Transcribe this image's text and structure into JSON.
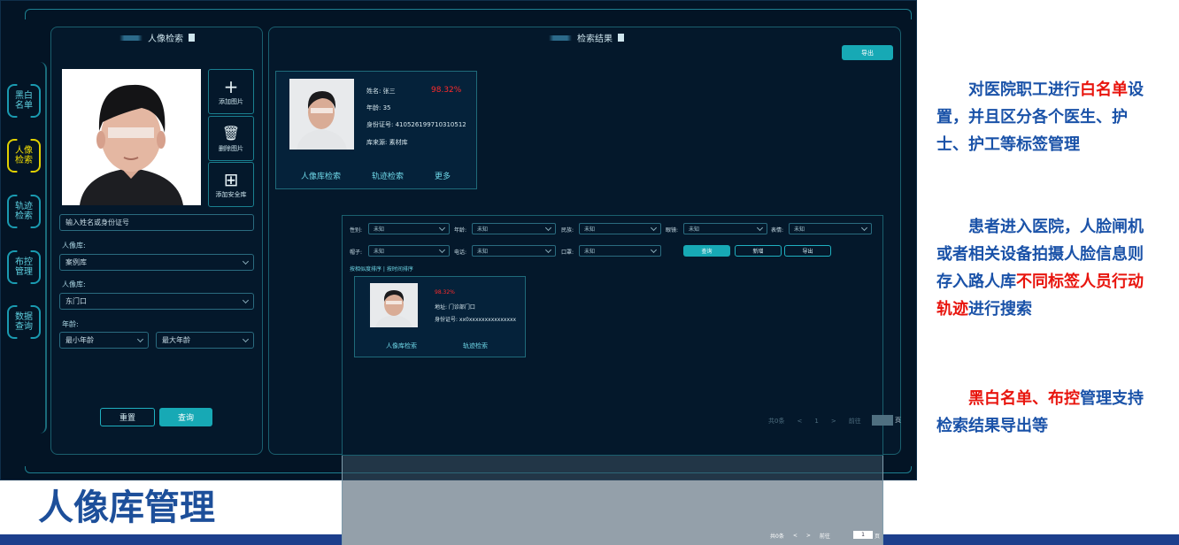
{
  "left_panel": {
    "title": "人像检索",
    "tools": [
      {
        "icon": "plus-icon",
        "glyph": "+",
        "label": "添加图片"
      },
      {
        "icon": "trash-icon",
        "glyph": "🗑",
        "label": "删除图片"
      },
      {
        "icon": "grid-icon",
        "glyph": "⊞",
        "label": "添加安全库"
      }
    ],
    "search_placeholder": "输入姓名或身份证号",
    "library_label_1": "人像库:",
    "library_value_1": "案例库",
    "library_label_2": "人像库:",
    "library_value_2": "东门口",
    "age_label": "年龄:",
    "age_min": "最小年龄",
    "age_max": "最大年龄",
    "reset_button": "重置",
    "search_button": "查询"
  },
  "sidebar": {
    "items": [
      {
        "label": "黑白\n名单",
        "active": false
      },
      {
        "label": "人像\n检索",
        "active": true
      },
      {
        "label": "轨迹\n检索",
        "active": false
      },
      {
        "label": "布控\n管理",
        "active": false
      },
      {
        "label": "数据\n查询",
        "active": false
      }
    ]
  },
  "results_panel": {
    "title": "检索结果",
    "export_button": "导出",
    "card1": {
      "name": "姓名: 张三",
      "score": "98.32%",
      "age": "年龄: 35",
      "id": "身份证号: 410526199710310512",
      "source": "库来源: 素材库",
      "link_portrait": "人像库检索",
      "link_track": "轨迹检索",
      "link_more": "更多"
    },
    "filter": {
      "gender_label": "性别:",
      "gender_value": "未知",
      "age_label": "年龄:",
      "age_value": "未知",
      "ethnic_label": "民族:",
      "ethnic_value": "未知",
      "glasses_label": "眼镜:",
      "glasses_value": "未知",
      "expression_label": "表情:",
      "expression_value": "未知",
      "hat_label": "帽子:",
      "hat_value": "未知",
      "phone_label": "电话:",
      "phone_value": "未知",
      "mask_label": "口罩:",
      "mask_value": "未知",
      "query_button": "查询",
      "add_button": "新增",
      "export_button": "导出",
      "sort_text": "按相似度排序 | 按时间排序",
      "card": {
        "score": "98.32%",
        "address": "地址: 门诊部门口",
        "id": "身份证号: xx0xxxxxxxxxxxxxxx",
        "link_portrait": "人像库检索",
        "link_track": "轨迹检索"
      },
      "pagination": {
        "total": "共0条",
        "prev": "<",
        "page": "1",
        "next": ">",
        "goto": "前往",
        "unit": "页"
      }
    }
  },
  "bottom_title": "人像库管理",
  "bottom_pagination": {
    "total": "共0条",
    "prev": "<",
    "next": ">",
    "goto": "前往",
    "page": "1",
    "unit": "页"
  },
  "description": {
    "para1_a": "对医院职工进行",
    "para1_b": "白名单",
    "para1_c": "设置，并且区分各个医生、护士、护工等标签管理",
    "para2_a": "患者进入医院，人脸闸机或者相关设备拍摄人脸信息则存入路人库",
    "para2_b": "不同标签人员行动轨迹",
    "para2_c": "进行搜索",
    "para3_a": "黑白名单、布控",
    "para3_b": "管理支持检索结果导出等"
  },
  "colors": {
    "accent": "#17a9b5",
    "background": "#031425",
    "description_blue": "#1a52a8",
    "description_red": "#e8150e",
    "title_blue": "#1d4f9a"
  }
}
